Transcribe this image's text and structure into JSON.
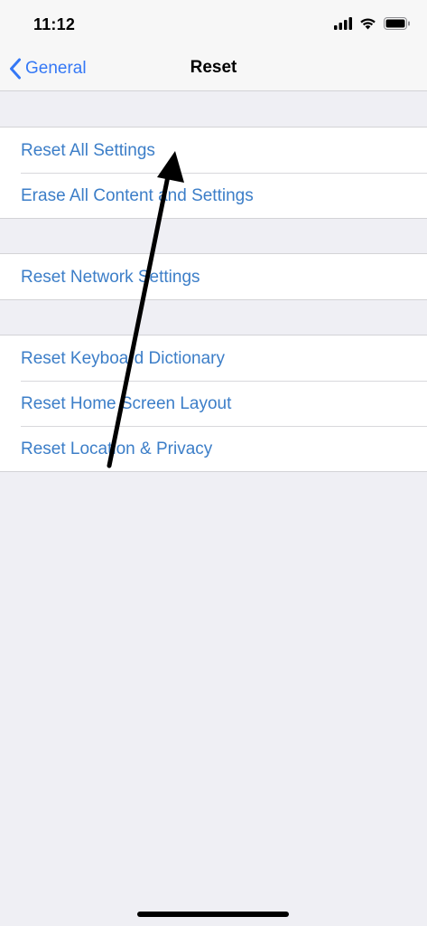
{
  "status_bar": {
    "time": "11:12",
    "icons": [
      "signal-icon",
      "wifi-icon",
      "battery-icon"
    ]
  },
  "nav": {
    "back_label": "General",
    "back_icon": "chevron-left-icon",
    "title": "Reset"
  },
  "groups": [
    {
      "rows": [
        {
          "label": "Reset All Settings"
        },
        {
          "label": "Erase All Content and Settings"
        }
      ]
    },
    {
      "rows": [
        {
          "label": "Reset Network Settings"
        }
      ]
    },
    {
      "rows": [
        {
          "label": "Reset Keyboard Dictionary"
        },
        {
          "label": "Reset Home Screen Layout"
        },
        {
          "label": "Reset Location & Privacy"
        }
      ]
    }
  ],
  "annotation": {
    "icon": "arrow-icon",
    "color": "#000000"
  },
  "colors": {
    "accent": "#3478f6",
    "row_text": "#3c7ec8",
    "background": "#efeff4"
  }
}
